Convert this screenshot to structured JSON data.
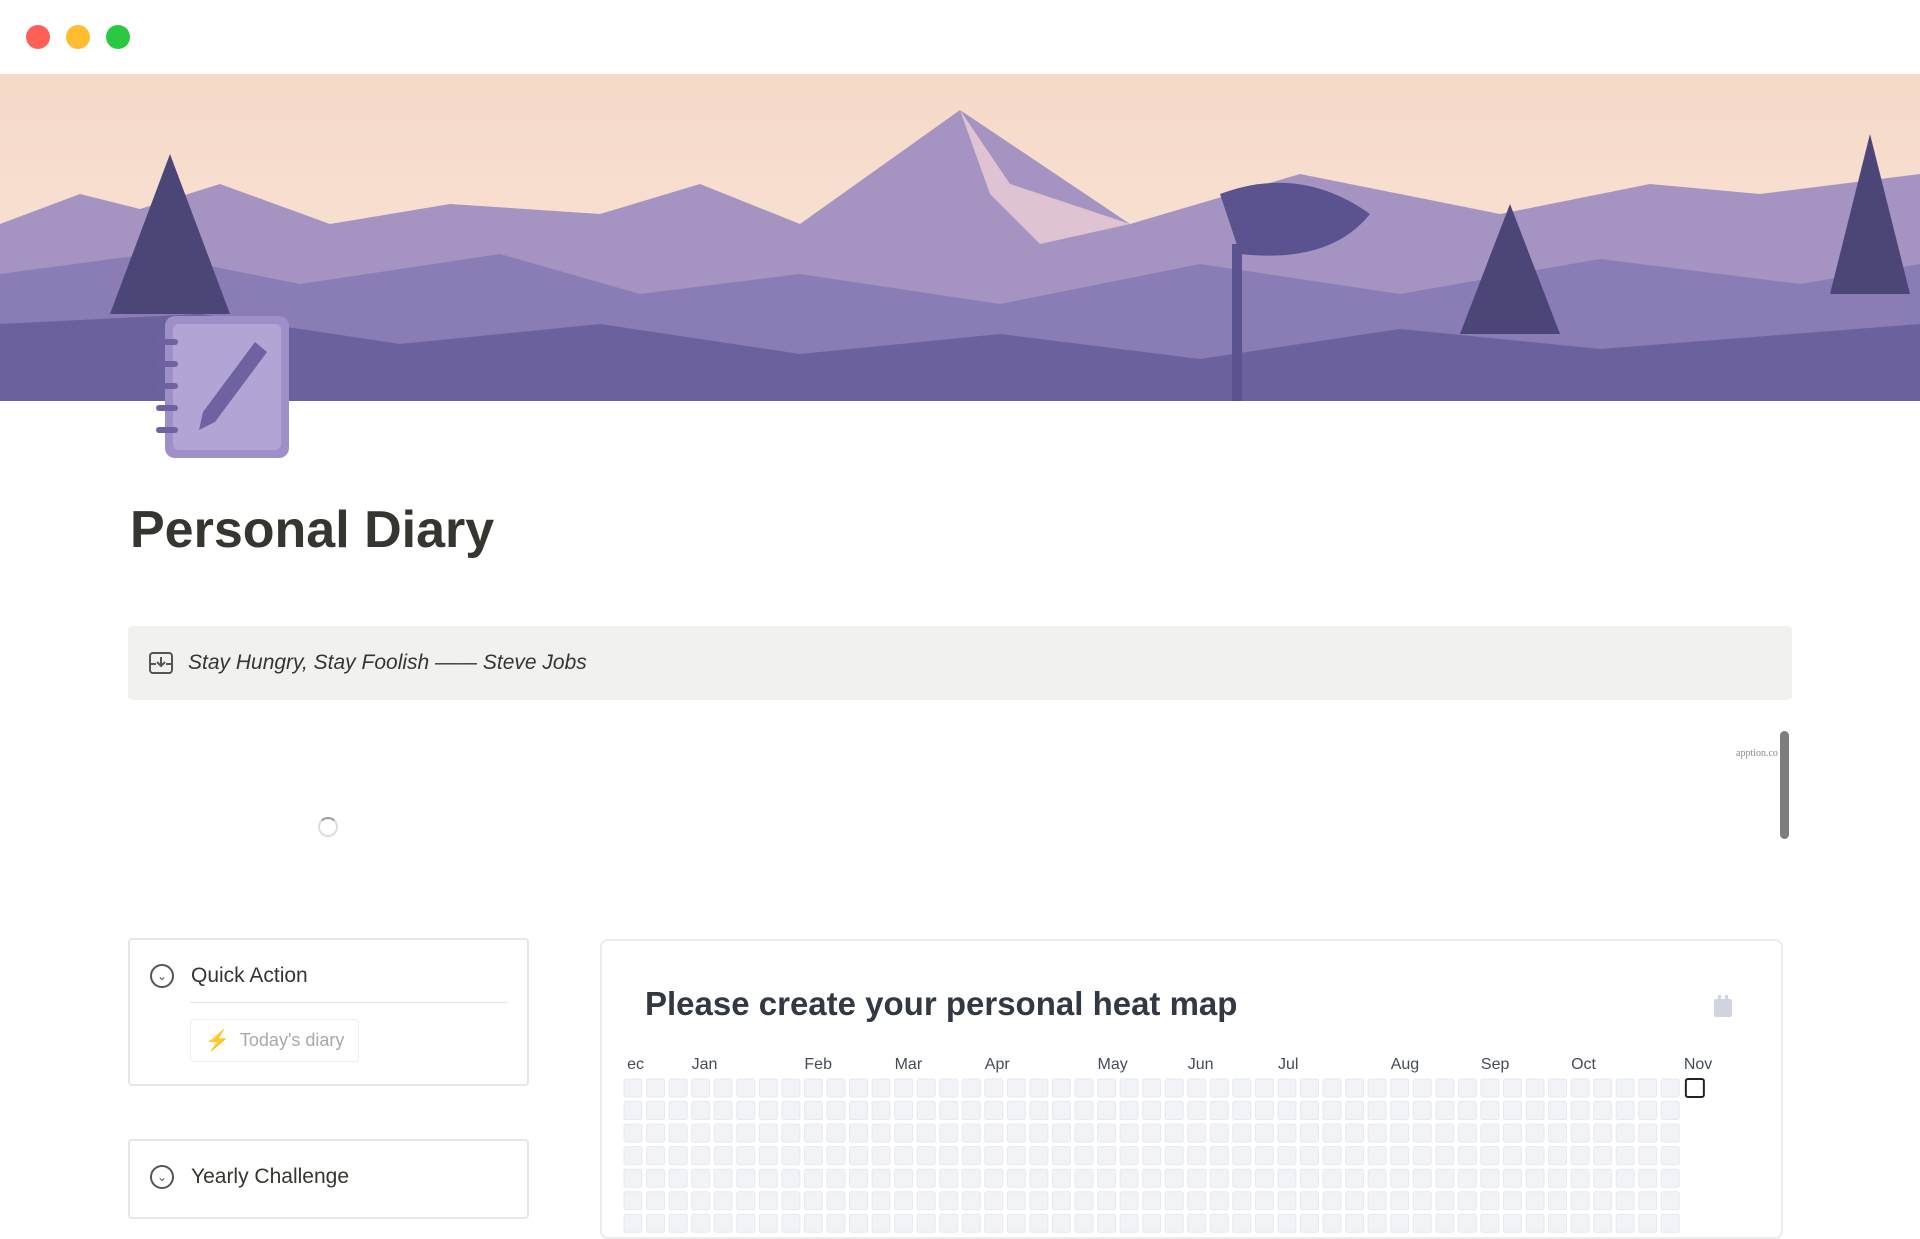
{
  "window": {
    "controls": [
      "close",
      "minimize",
      "maximize"
    ],
    "colors": {
      "close": "#fe5f57",
      "minimize": "#febc2e",
      "maximize": "#28c840"
    }
  },
  "page": {
    "title": "Personal Diary",
    "icon": "notebook-pencil-icon",
    "cover": "purple-mountain-landscape"
  },
  "callout": {
    "icon": "archive-download-icon",
    "text": "Stay Hungry, Stay Foolish —— Steve Jobs"
  },
  "embed": {
    "credit": "apption.co",
    "status": "loading"
  },
  "quick_action": {
    "title": "Quick Action",
    "button": "Today's diary",
    "button_icon": "lightning-icon"
  },
  "yearly_challenge": {
    "title": "Yearly Challenge"
  },
  "heatmap": {
    "title": "Please create your personal heat map",
    "icon": "calendar-icon",
    "months": [
      {
        "label": "ec",
        "week": 0
      },
      {
        "label": "Jan",
        "week": 3
      },
      {
        "label": "Feb",
        "week": 8
      },
      {
        "label": "Mar",
        "week": 12
      },
      {
        "label": "Apr",
        "week": 16
      },
      {
        "label": "May",
        "week": 21
      },
      {
        "label": "Jun",
        "week": 25
      },
      {
        "label": "Jul",
        "week": 29
      },
      {
        "label": "Aug",
        "week": 34
      },
      {
        "label": "Sep",
        "week": 38
      },
      {
        "label": "Oct",
        "week": 42
      },
      {
        "label": "Nov",
        "week": 47
      }
    ],
    "weeks": 48,
    "empty_color": "#f1f3f7",
    "today_week": 47
  }
}
